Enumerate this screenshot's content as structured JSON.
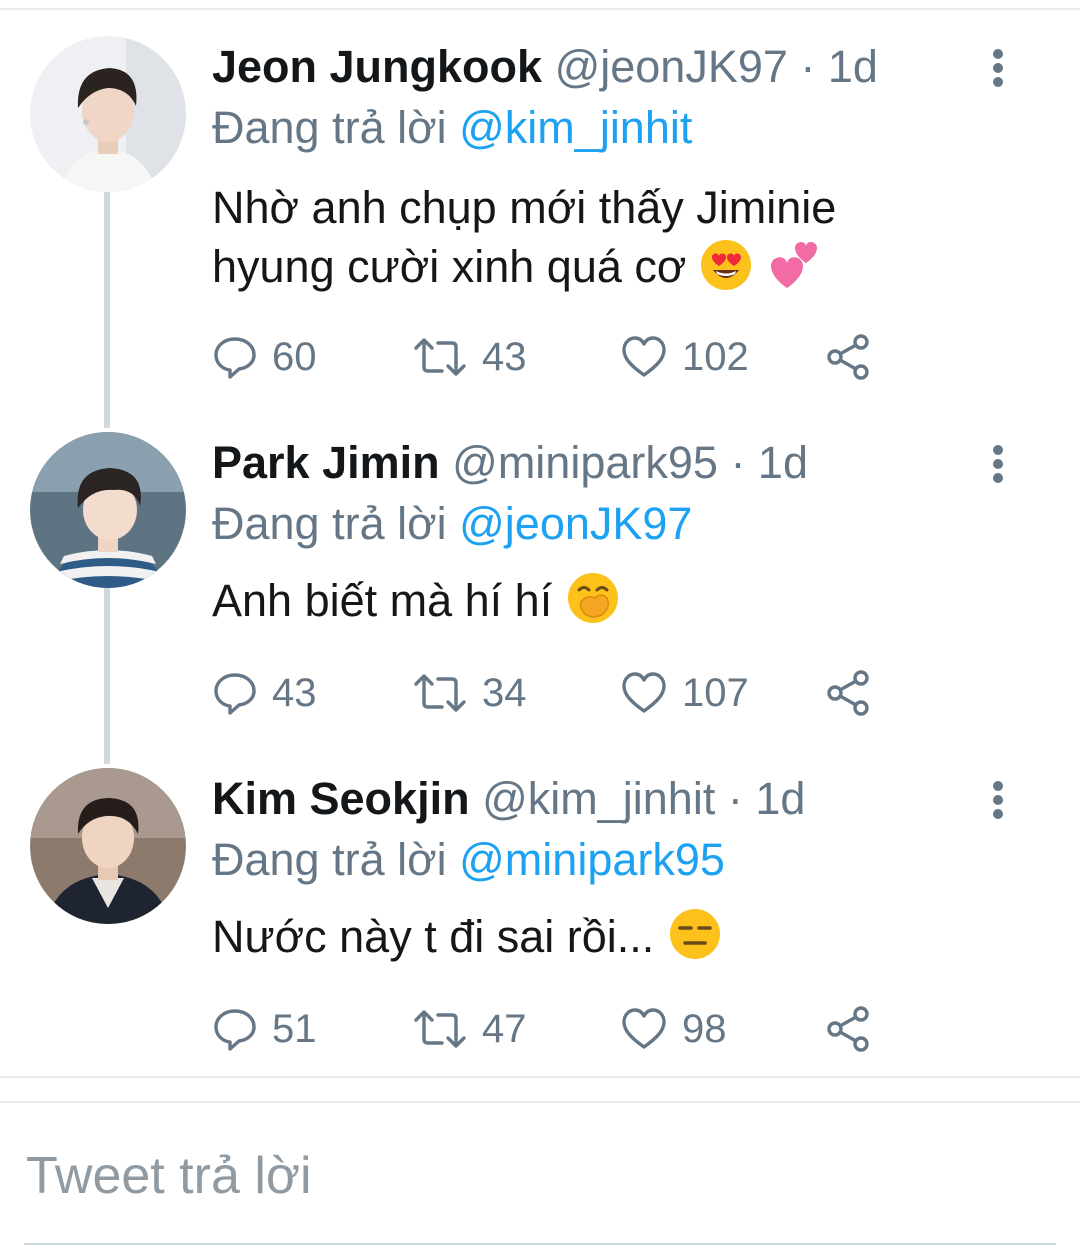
{
  "tweets": [
    {
      "name": "Jeon Jungkook",
      "handle": "@jeonJK97",
      "time": "· 1d",
      "replying_prefix": "Đang trả lời",
      "replying_to": "@kim_jinhit",
      "text_line1": "Nhờ anh chụp mới thấy Jiminie",
      "text_line2": "hyung cười xinh quá cơ",
      "emojis": [
        "heart-eyes-emoji",
        "two-hearts-emoji"
      ],
      "replies": "60",
      "retweets": "43",
      "likes": "102"
    },
    {
      "name": "Park Jimin",
      "handle": "@minipark95",
      "time": "· 1d",
      "replying_prefix": "Đang trả lời",
      "replying_to": "@jeonJK97",
      "text_line1": "Anh biết mà hí hí",
      "emojis": [
        "hand-over-mouth-emoji"
      ],
      "replies": "43",
      "retweets": "34",
      "likes": "107"
    },
    {
      "name": "Kim Seokjin",
      "handle": "@kim_jinhit",
      "time": "· 1d",
      "replying_prefix": "Đang trả lời",
      "replying_to": "@minipark95",
      "text_line1": "Nước này t đi sai rồi...",
      "emojis": [
        "expressionless-emoji"
      ],
      "replies": "51",
      "retweets": "47",
      "likes": "98"
    }
  ],
  "compose": {
    "placeholder": "Tweet trả lời"
  },
  "colors": {
    "accent": "#1da1f2",
    "muted": "#657786",
    "text": "#14171a",
    "divider": "#e6ecf0"
  },
  "icons": [
    "reply-icon",
    "retweet-icon",
    "like-icon",
    "share-icon",
    "more-icon"
  ]
}
